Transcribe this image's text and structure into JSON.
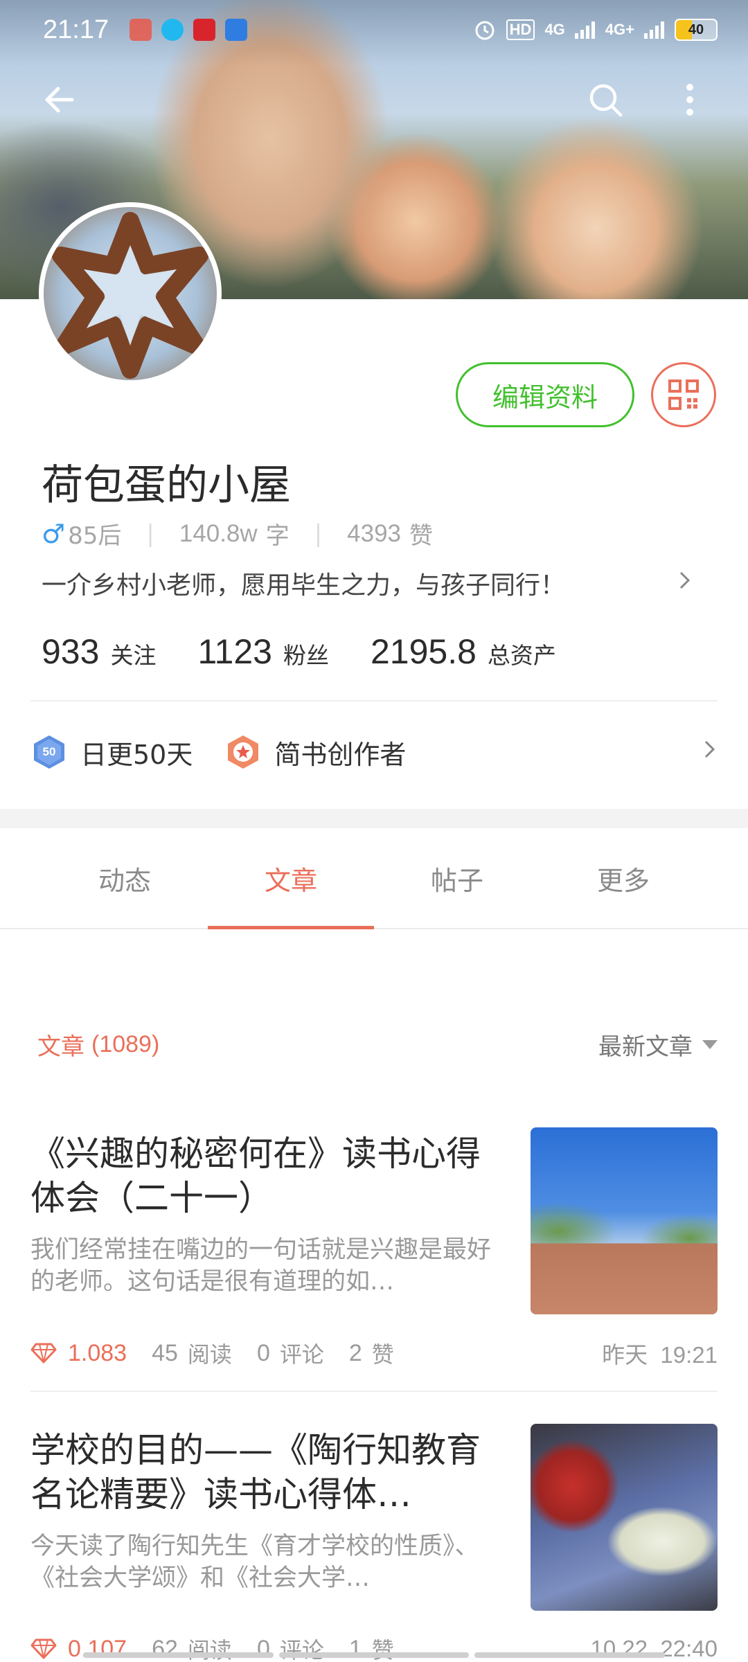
{
  "status_bar": {
    "time": "21:17",
    "hd": "HD",
    "net1": "4G",
    "net2": "4G+",
    "battery": "40"
  },
  "header": {
    "back_icon": "arrow-left-icon",
    "search_icon": "search-icon",
    "more_icon": "more-vertical-icon"
  },
  "profile": {
    "name": "荷包蛋的小屋",
    "edit_label": "编辑资料",
    "gender_symbol": "♂",
    "age_group": "85后",
    "word_count": "140.8w",
    "word_unit": "字",
    "likes": "4393",
    "likes_unit": "赞",
    "bio": "一介乡村小老师，愿用毕生之力，与孩子同行！",
    "stats": [
      {
        "value": "933",
        "label": "关注"
      },
      {
        "value": "1123",
        "label": "粉丝"
      },
      {
        "value": "2195.8",
        "label": "总资产"
      }
    ],
    "badges": [
      {
        "icon_text": "50",
        "label": "日更50天"
      },
      {
        "label": "简书创作者"
      }
    ]
  },
  "tabs": [
    {
      "label": "动态"
    },
    {
      "label": "文章"
    },
    {
      "label": "帖子"
    },
    {
      "label": "更多"
    }
  ],
  "section": {
    "title": "文章",
    "count": "(1089)",
    "sort_label": "最新文章"
  },
  "articles": [
    {
      "title": "《兴趣的秘密何在》读书心得体会（二十一）",
      "abstract": "我们经常挂在嘴边的一句话就是兴趣是最好的老师。这句话是很有道理的如…",
      "diamond": "1.083",
      "reads": "45",
      "reads_label": "阅读",
      "comments": "0",
      "comments_label": "评论",
      "likes": "2",
      "likes_label": "赞",
      "time": "昨天  19:21"
    },
    {
      "title": "学校的目的——《陶行知教育名论精要》读书心得体…",
      "abstract": "今天读了陶行知先生《育才学校的性质》、《社会大学颂》和《社会大学…",
      "diamond": "0.107",
      "reads": "62",
      "reads_label": "阅读",
      "comments": "0",
      "comments_label": "评论",
      "likes": "1",
      "likes_label": "赞",
      "time": "10.22  22:40"
    }
  ],
  "colors": {
    "accent": "#ea6f5a",
    "green": "#42c02e",
    "gender_blue": "#3b9bea"
  }
}
